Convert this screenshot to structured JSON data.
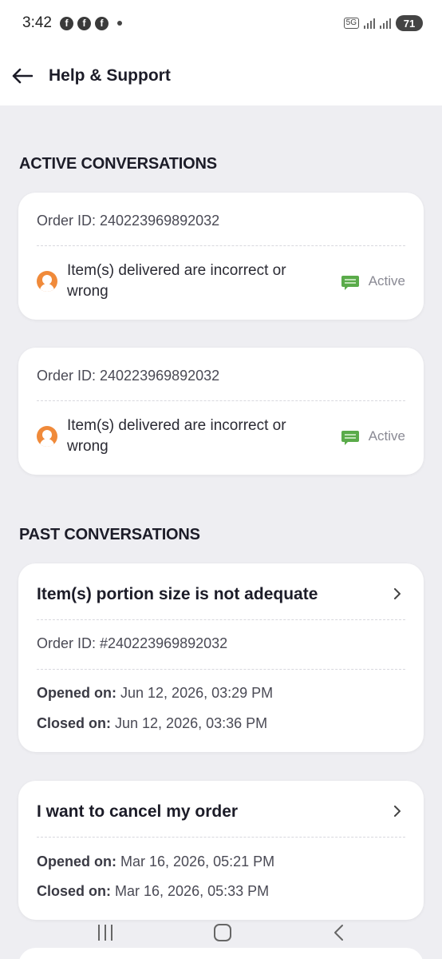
{
  "statusbar": {
    "time": "3:42",
    "network": "5G",
    "battery": "71"
  },
  "header": {
    "title": "Help & Support"
  },
  "active": {
    "heading": "ACTIVE CONVERSATIONS",
    "items": [
      {
        "order": "Order ID: 240223969892032",
        "issue": "Item(s) delivered are incorrect or wrong",
        "status": "Active"
      },
      {
        "order": "Order ID: 240223969892032",
        "issue": "Item(s) delivered are incorrect or wrong",
        "status": "Active"
      }
    ]
  },
  "past": {
    "heading": "PAST CONVERSATIONS",
    "items": [
      {
        "title": "Item(s) portion size is not adequate",
        "order": "Order ID: #240223969892032",
        "opened_label": "Opened on:",
        "opened": "Jun 12, 2026, 03:29 PM",
        "closed_label": "Closed on:",
        "closed": "Jun 12, 2026, 03:36 PM"
      },
      {
        "title": "I want to cancel my order",
        "opened_label": "Opened on:",
        "opened": "Mar 16, 2026, 05:21 PM",
        "closed_label": "Closed on:",
        "closed": "Mar 16, 2026, 05:33 PM"
      }
    ]
  },
  "icons": {
    "back": "arrow-left-icon",
    "chevron": "chevron-right-icon",
    "avatar": "user-avatar-icon",
    "chat": "chat-bubble-icon"
  },
  "colors": {
    "active_status": "#5aab4a",
    "avatar": "#f08a3a",
    "background": "#eeeef2"
  }
}
